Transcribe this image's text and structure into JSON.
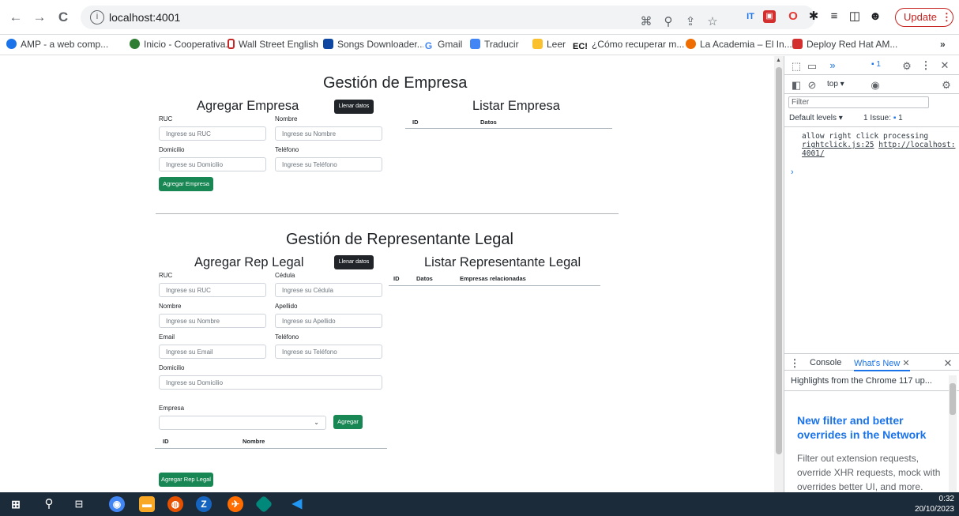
{
  "browser": {
    "url": "localhost:4001",
    "update_label": "Update",
    "bookmarks": [
      {
        "label": "AMP - a web comp...",
        "color": "#1a73e8"
      },
      {
        "label": "Inicio - Cooperativa...",
        "color": "#2e7d32"
      },
      {
        "label": "Wall Street English",
        "color": "#c62828"
      },
      {
        "label": "Songs Downloader...",
        "color": "#0d47a1"
      },
      {
        "label": "Gmail",
        "color": "#4285f4"
      },
      {
        "label": "Traducir",
        "color": "#4285f4"
      },
      {
        "label": "Leer",
        "color": "#fbc02d"
      },
      {
        "label": "¿Cómo recuperar m...",
        "color": "#111111"
      },
      {
        "label": "La Academia – El In...",
        "color": "#ef6c00"
      },
      {
        "label": "Deploy Red Hat AM...",
        "color": "#d32f2f"
      }
    ],
    "more_label": "»"
  },
  "empresa": {
    "title": "Gestión de Empresa",
    "add_title": "Agregar Empresa",
    "fill_button": "Llenar datos",
    "list_title": "Listar Empresa",
    "fields": {
      "ruc": {
        "label": "RUC",
        "placeholder": "Ingrese su RUC"
      },
      "nombre": {
        "label": "Nombre",
        "placeholder": "Ingrese su Nombre"
      },
      "domicilio": {
        "label": "Domicilio",
        "placeholder": "Ingrese su Domicilio"
      },
      "telefono": {
        "label": "Teléfono",
        "placeholder": "Ingrese su Teléfono"
      }
    },
    "submit_button": "Agregar Empresa",
    "table_headers": [
      "ID",
      "Datos"
    ]
  },
  "representante": {
    "title": "Gestión de Representante Legal",
    "add_title": "Agregar Rep Legal",
    "fill_button": "Llenar datos",
    "list_title": "Listar Representante Legal",
    "fields": {
      "ruc": {
        "label": "RUC",
        "placeholder": "Ingrese su RUC"
      },
      "cedula": {
        "label": "Cédula",
        "placeholder": "Ingrese su Cédula"
      },
      "nombre": {
        "label": "Nombre",
        "placeholder": "Ingrese su Nombre"
      },
      "apellido": {
        "label": "Apellido",
        "placeholder": "Ingrese su Apellido"
      },
      "email": {
        "label": "Email",
        "placeholder": "Ingrese su Email"
      },
      "telefono": {
        "label": "Teléfono",
        "placeholder": "Ingrese su Teléfono"
      },
      "domicilio": {
        "label": "Domicilio",
        "placeholder": "Ingrese su Domicilio"
      }
    },
    "empresa_label": "Empresa",
    "agregar_button": "Agregar",
    "empresa_table_headers": [
      "ID",
      "Nombre"
    ],
    "submit_button": "Agregar Rep Legal",
    "table_headers": [
      "ID",
      "Datos",
      "Empresas relacionadas"
    ]
  },
  "devtools": {
    "context": "top",
    "filter_placeholder": "Filter",
    "levels": "Default levels",
    "issues": "1 Issue:",
    "issue_count": "1",
    "badge_count": "1",
    "log_text": "allow right click processing",
    "log_link1": "rightclick.js:25",
    "log_link2": "http://localhost:4001/",
    "drawer_tabs": [
      "Console",
      "What's New"
    ],
    "whatsnew_header": "Highlights from the Chrome 117 up...",
    "whatsnew_title": "New filter and better overrides in the Network panel",
    "whatsnew_body": "Filter out extension requests, override XHR requests, mock with overrides better UI, and more."
  },
  "taskbar": {
    "time": "0:32",
    "date": "20/10/2023"
  }
}
